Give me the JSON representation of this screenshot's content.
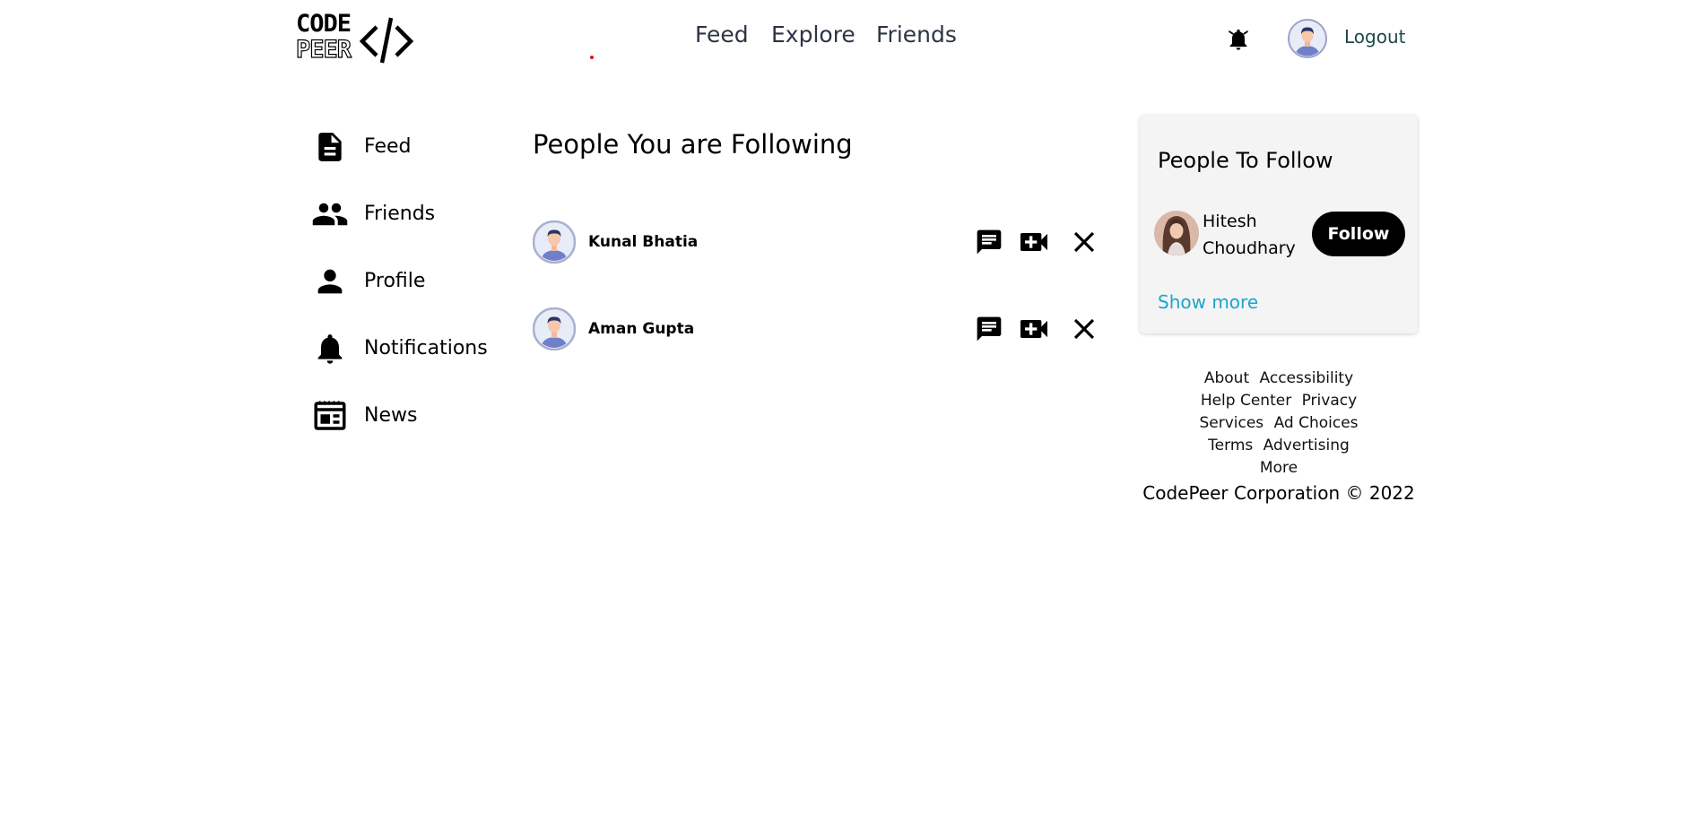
{
  "header": {
    "logo_top": "CODE",
    "logo_bottom": "PEER",
    "nav": [
      {
        "label": "Feed"
      },
      {
        "label": "Explore"
      },
      {
        "label": "Friends"
      }
    ],
    "notification_icon": "bell-icon",
    "logout_label": "Logout"
  },
  "sidebar": {
    "items": [
      {
        "label": "Feed",
        "icon": "article-icon"
      },
      {
        "label": "Friends",
        "icon": "people-icon"
      },
      {
        "label": "Profile",
        "icon": "person-icon"
      },
      {
        "label": "Notifications",
        "icon": "bell-icon"
      },
      {
        "label": "News",
        "icon": "newspaper-icon"
      }
    ]
  },
  "main": {
    "title": "People You are Following",
    "following": [
      {
        "name": "Kunal Bhatia"
      },
      {
        "name": "Aman Gupta"
      }
    ],
    "row_actions": [
      "chat-icon",
      "video-call-icon",
      "close-icon"
    ]
  },
  "suggestions": {
    "title": "People To Follow",
    "people": [
      {
        "name": "Hitesh Choudhary",
        "follow_label": "Follow"
      }
    ],
    "show_more_label": "Show more"
  },
  "footer": {
    "rows": [
      [
        "About",
        "Accessibility"
      ],
      [
        "Help Center",
        "Privacy"
      ],
      [
        "Services",
        "Ad Choices"
      ],
      [
        "Terms",
        "Advertising"
      ],
      [
        "More"
      ]
    ],
    "copyright": "CodePeer Corporation © 2022"
  },
  "colors": {
    "nav_text": "#2c3545",
    "logout_text": "#1c4a48",
    "show_more": "#1ba5cc",
    "card_bg": "#f4f4f4",
    "follow_bg": "#000000"
  }
}
